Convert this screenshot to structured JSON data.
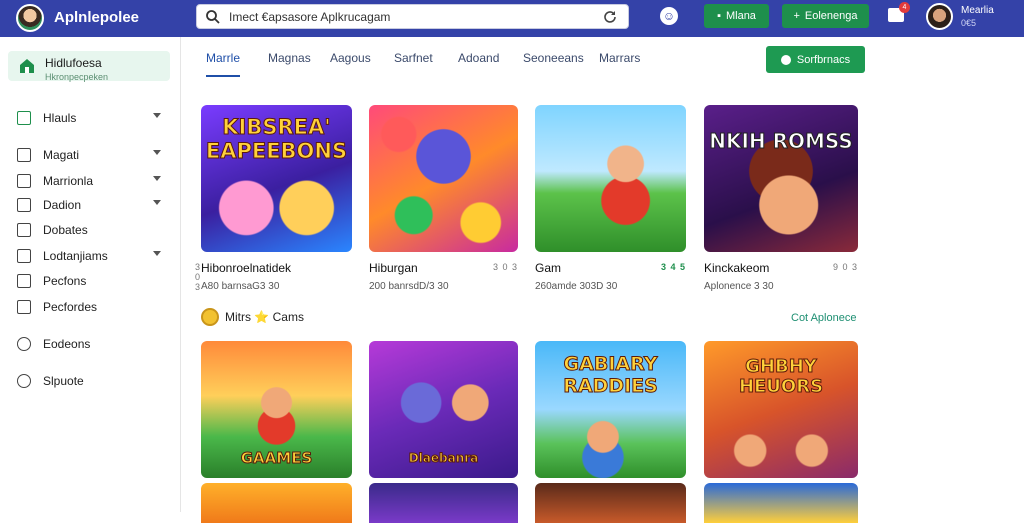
{
  "app": {
    "title": "Aplnlepolee"
  },
  "search": {
    "value": "Imect €apsasore Aplkrucagam"
  },
  "topbar": {
    "button1": "Mlana",
    "button2": "Eolenenga",
    "notification_count": "4",
    "user_name": "Mearlia",
    "user_sub": "0€5",
    "colors": {
      "bar": "#3442a8",
      "green": "#1e8f4c"
    }
  },
  "sidebar": {
    "active": {
      "label": "Hidlufoesa",
      "sub": "Hkronpecpeken"
    },
    "items": [
      {
        "label": "Hlauls",
        "icon": "grid-icon",
        "chevron": true
      },
      {
        "label": "Magati",
        "icon": "folder-icon",
        "chevron": true
      },
      {
        "label": "Marrionla",
        "icon": "window-icon",
        "chevron": true
      },
      {
        "label": "Dadion",
        "icon": "box-icon",
        "chevron": true
      },
      {
        "label": "Dobates",
        "icon": "bookmark-icon",
        "chevron": false
      },
      {
        "label": "Lodtanjiams",
        "icon": "layers-icon",
        "chevron": true
      },
      {
        "label": "Pecfons",
        "icon": "pen-icon",
        "chevron": false
      },
      {
        "label": "Pecfordes",
        "icon": "calendar-icon",
        "chevron": false
      },
      {
        "label": "Eodeons",
        "icon": "circle-icon",
        "chevron": false
      },
      {
        "label": "Slpuote",
        "icon": "person-icon",
        "chevron": false
      }
    ]
  },
  "tabs": [
    "Marrle",
    "Magnas",
    "Aagous",
    "Sarfnet",
    "Adoand",
    "Seoneeans",
    "Marrars"
  ],
  "cta_label": "Sorfbrnacs",
  "games_row1": [
    {
      "title": "Hibonroelnatidek",
      "rating": "3 0 3",
      "meta": "A80 barnsaG3 30",
      "art": "KIBSREA' EAPEEBONS"
    },
    {
      "title": "Hiburgan",
      "rating": "3 0 3",
      "meta": "200 banrsdD/3 30",
      "art": ""
    },
    {
      "title": "Gam",
      "rating": "3 4 5",
      "meta": "260amde 303D 30",
      "art": ""
    },
    {
      "title": "Kinckakeom",
      "rating": "9 0 3",
      "meta": "Aplonence 3 30",
      "art": "NKIH ROMSS"
    }
  ],
  "section": {
    "title": "Mitrs ⭐ Cams",
    "see_all": "Cot Aplonece"
  },
  "games_row2": [
    {
      "art": "GAAMES"
    },
    {
      "art": "Dlaebanra"
    },
    {
      "art": "GABIARY RADDIES"
    },
    {
      "art": "GHBHY HEUORS"
    }
  ]
}
